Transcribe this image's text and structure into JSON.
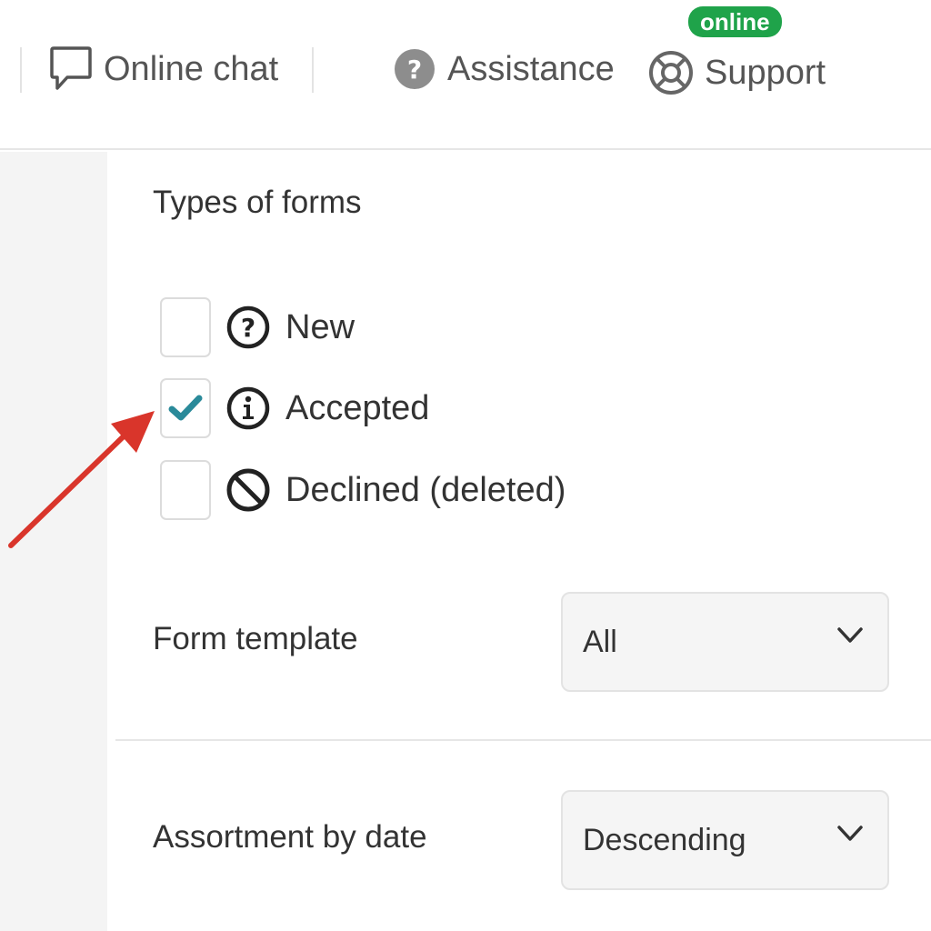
{
  "header": {
    "online_chat_label": "Online chat",
    "assistance_label": "Assistance",
    "support_label": "Support",
    "online_badge": "online",
    "badge_color": "#1fa34a"
  },
  "filters": {
    "types_title": "Types of forms",
    "types": [
      {
        "label": "New",
        "checked": false,
        "icon": "question-circle-icon"
      },
      {
        "label": "Accepted",
        "checked": true,
        "icon": "info-circle-icon"
      },
      {
        "label": "Declined (deleted)",
        "checked": false,
        "icon": "prohibited-icon"
      }
    ],
    "form_template_label": "Form template",
    "form_template_value": "All",
    "sort_label": "Assortment by date",
    "sort_value": "Descending"
  },
  "colors": {
    "check_color": "#2a8a9a",
    "annotation_arrow": "#d9352b"
  }
}
